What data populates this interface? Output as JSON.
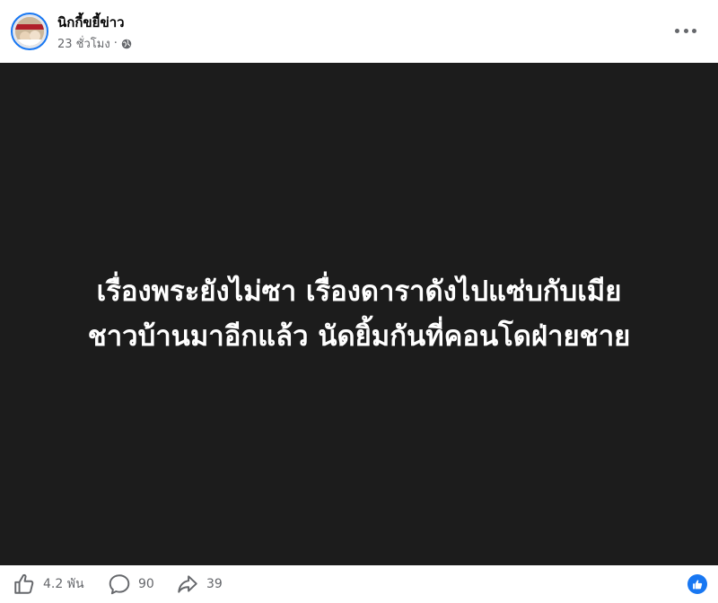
{
  "post": {
    "author": "นิกกี้ขยี้ข่าว",
    "time": "23 ชั่วโมง",
    "privacy_separator": "·",
    "image_text": {
      "line1": "เรื่องพระยังไม่ซา เรื่องดาราดังไปแซ่บกับเมีย",
      "line2": "ชาวบ้านมาอีกแล้ว นัดยิ้มกันที่คอนโดฝ่ายชาย"
    }
  },
  "stats": {
    "likes": "4.2 พัน",
    "comments": "90",
    "shares": "39"
  },
  "icons": {
    "more": "more-options-icon",
    "privacy": "globe-icon",
    "like": "thumbs-up-icon",
    "comment": "comment-icon",
    "share": "share-icon",
    "reaction": "like-reaction-icon"
  },
  "colors": {
    "accent": "#1877f2",
    "image_bg": "#1c1c1c",
    "secondary_text": "#65676b"
  }
}
